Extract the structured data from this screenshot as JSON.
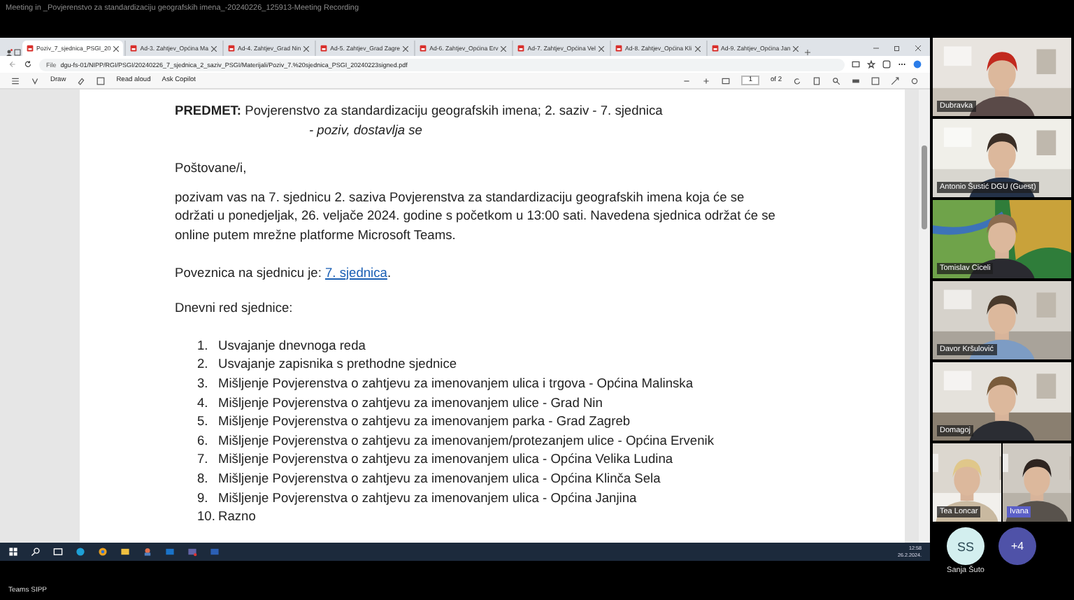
{
  "meeting_title": "Meeting in _Povjerenstvo za standardizaciju geografskih imena_-20240226_125913-Meeting Recording",
  "browser": {
    "tabs": [
      {
        "label": "Poziv_7_sjednica_PSGI_20",
        "selected": true
      },
      {
        "label": "Ad-3. Zahtjev_Općina Ma",
        "selected": false
      },
      {
        "label": "Ad-4. Zahtjev_Grad Nin",
        "selected": false
      },
      {
        "label": "Ad-5. Zahtjev_Grad Zagre",
        "selected": false
      },
      {
        "label": "Ad-6. Zahtjev_Općina Erv",
        "selected": false
      },
      {
        "label": "Ad-7. Zahtjev_Općina Vel",
        "selected": false
      },
      {
        "label": "Ad-8. Zahtjev_Općina Kli",
        "selected": false
      },
      {
        "label": "Ad-9. Zahtjev_Općina Jan",
        "selected": false
      }
    ],
    "address": {
      "scheme": "File",
      "url": "dgu-fs-01/NIPP/RGI/PSGI/20240226_7_sjednica_2_saziv_PSGI/Materijali/Poziv_7.%20sjednica_PSGI_20240223signed.pdf"
    },
    "pdf_toolbar": {
      "draw": "Draw",
      "read_aloud": "Read aloud",
      "ask_copilot": "Ask Copilot",
      "page": "1",
      "page_count": "of 2"
    }
  },
  "document": {
    "subject": "**PREDMET:** Povjerenstvo za standardizaciju geografskih imena; 2. saziv - 7. sjednica",
    "subject_note": "- poziv, dostavlja se",
    "greeting": "Poštovane/i,",
    "body": "pozivam vas na 7. sjednicu 2. saziva Povjerenstva za standardizaciju geografskih imena koja će se održati u ponedjeljak, 26. veljače 2024. godine s početkom u 13:00 sati. Navedena sjednica održat će se online putem mrežne platforme Microsoft Teams.",
    "link_line": {
      "before": "Poveznica na sjednicu je: ",
      "link": "7. sjednica",
      "after": "."
    },
    "agenda_title": "Dnevni red sjednice:",
    "agenda": [
      {
        "number": "1.",
        "text": "Usvajanje dnevnoga reda"
      },
      {
        "number": "2.",
        "text": "Usvajanje zapisnika s prethodne sjednice"
      },
      {
        "number": "3.",
        "text": "Mišljenje Povjerenstva o zahtjevu za imenovanjem ulica i trgova - Općina Malinska"
      },
      {
        "number": "4.",
        "text": "Mišljenje Povjerenstva o zahtjevu za imenovanjem ulice - Grad Nin"
      },
      {
        "number": "5.",
        "text": "Mišljenje Povjerenstva o zahtjevu za imenovanjem parka - Grad Zagreb"
      },
      {
        "number": "6.",
        "text": "Mišljenje Povjerenstva o zahtjevu za imenovanjem/protezanjem ulice - Općina Ervenik"
      },
      {
        "number": "7.",
        "text": "Mišljenje Povjerenstva o zahtjevu za imenovanjem ulica - Općina Velika Ludina"
      },
      {
        "number": "8.",
        "text": "Mišljenje Povjerenstva o zahtjevu za imenovanjem ulica - Općina Klinča Sela"
      },
      {
        "number": "9.",
        "text": "Mišljenje Povjerenstva o zahtjevu za imenovanjem ulica - Općina Janjina"
      },
      {
        "number": "10.",
        "text": "Razno"
      }
    ]
  },
  "taskbar": {
    "time": "12:58",
    "date": "26.2.2024."
  },
  "participants": [
    [
      {
        "name": "Dubravka",
        "highlighted": false
      }
    ],
    [
      {
        "name": "Antonio Šustić DGU (Guest)",
        "highlighted": false
      }
    ],
    [
      {
        "name": "Tomislav Ciceli",
        "highlighted": false
      }
    ],
    [
      {
        "name": "Davor Kršulović",
        "highlighted": false
      }
    ],
    [
      {
        "name": "Domagoj",
        "highlighted": false
      }
    ],
    [
      {
        "name": "Tea Loncar",
        "highlighted": false
      },
      {
        "name": "Ivana",
        "highlighted": true
      }
    ]
  ],
  "avatars": [
    {
      "initials": "SS",
      "name": "Sanja Šuto"
    }
  ],
  "overflow_count": "+4",
  "footer": "Teams SIPP"
}
